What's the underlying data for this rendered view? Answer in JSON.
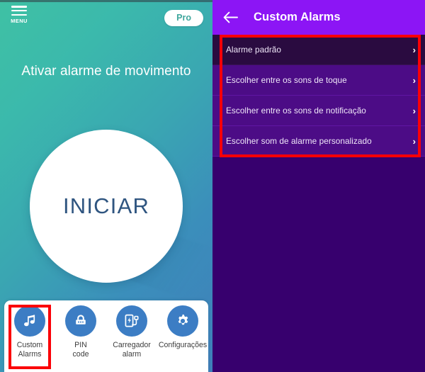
{
  "left_app": {
    "menu": {
      "label": "MENU",
      "icon": "hamburger-menu-icon"
    },
    "pro_badge": {
      "label": "Pro"
    },
    "headline": "Ativar alarme de movimento",
    "start_button": {
      "label": "INICIAR"
    },
    "bottom_nav": [
      {
        "icon": "music-note-icon",
        "label": "Custom\nAlarms",
        "label_line1": "Custom",
        "label_line2": "Alarms"
      },
      {
        "icon": "pin-lock-icon",
        "label": "PIN code",
        "label_line1": "PIN",
        "label_line2": "code"
      },
      {
        "icon": "phone-charger-icon",
        "label": "Carregador alarm",
        "label_line1": "Carregador",
        "label_line2": "alarm"
      },
      {
        "icon": "gear-icon",
        "label": "Configurações",
        "label_line1": "Configurações",
        "label_line2": ""
      }
    ],
    "colors": {
      "gradient_start": "#3fc1a4",
      "gradient_end": "#3f7fba",
      "nav_icon_bg": "#3c7dc4",
      "start_text": "#2f5580"
    }
  },
  "right_app": {
    "app_bar": {
      "back_icon": "arrow-left-icon",
      "title": "Custom Alarms"
    },
    "list_items": [
      {
        "label": "Alarme padrão",
        "chevron": "›"
      },
      {
        "label": "Escolher entre os sons de toque",
        "chevron": "›"
      },
      {
        "label": "Escolher entre os sons de notificação",
        "chevron": "›"
      },
      {
        "label": "Escolher som de alarme personalizado",
        "chevron": "›"
      }
    ],
    "colors": {
      "app_bar": "#8c15f5",
      "background": "#37006e",
      "row": "#4c0c86",
      "row_selected": "#2a0b40"
    }
  },
  "annotations": {
    "color": "#fb0007",
    "boxes": [
      {
        "name": "alarm-list-highlight"
      },
      {
        "name": "custom-alarms-nav-highlight"
      }
    ]
  }
}
